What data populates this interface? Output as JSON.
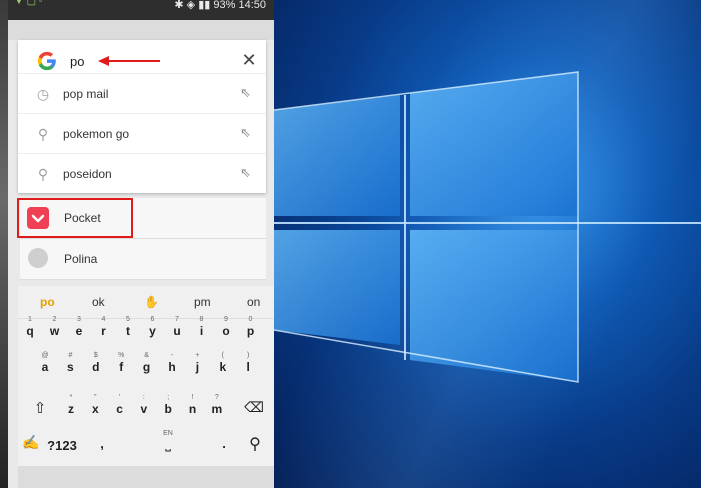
{
  "status_bar": {
    "battery": "93%",
    "time": "14:50"
  },
  "search": {
    "query": "po",
    "clear_icon": "close-icon",
    "suggestions": [
      {
        "text": "pop mail",
        "icon": "history-icon"
      },
      {
        "text": "pokemon go",
        "icon": "search-icon"
      },
      {
        "text": "poseidon",
        "icon": "search-icon"
      }
    ]
  },
  "results": [
    {
      "label": "Pocket",
      "icon": "pocket-icon"
    },
    {
      "label": "Polina",
      "icon": "avatar"
    }
  ],
  "keyboard": {
    "predictions": [
      "po",
      "ok",
      "pm",
      "on"
    ],
    "row1": [
      {
        "hint": "1",
        "key": "q"
      },
      {
        "hint": "2",
        "key": "w"
      },
      {
        "hint": "3",
        "key": "e"
      },
      {
        "hint": "4",
        "key": "r"
      },
      {
        "hint": "5",
        "key": "t"
      },
      {
        "hint": "6",
        "key": "y"
      },
      {
        "hint": "7",
        "key": "u"
      },
      {
        "hint": "8",
        "key": "i"
      },
      {
        "hint": "9",
        "key": "o"
      },
      {
        "hint": "0",
        "key": "p"
      }
    ],
    "row2": [
      {
        "hint": "@",
        "key": "a"
      },
      {
        "hint": "#",
        "key": "s"
      },
      {
        "hint": "$",
        "key": "d"
      },
      {
        "hint": "%",
        "key": "f"
      },
      {
        "hint": "&",
        "key": "g"
      },
      {
        "hint": "-",
        "key": "h"
      },
      {
        "hint": "+",
        "key": "j"
      },
      {
        "hint": "(",
        "key": "k"
      },
      {
        "hint": ")",
        "key": "l"
      }
    ],
    "row3": [
      {
        "hint": "*",
        "key": "z"
      },
      {
        "hint": "\"",
        "key": "x"
      },
      {
        "hint": "'",
        "key": "c"
      },
      {
        "hint": ":",
        "key": "v"
      },
      {
        "hint": ";",
        "key": "b"
      },
      {
        "hint": "!",
        "key": "n"
      },
      {
        "hint": "?",
        "key": "m"
      }
    ],
    "symbols_label": "?123",
    "comma": ",",
    "space_hint": "EN",
    "period": "."
  },
  "colors": {
    "highlight": "#e01b1b",
    "pocket": "#ef4056",
    "prediction_accent": "#e8a000"
  }
}
